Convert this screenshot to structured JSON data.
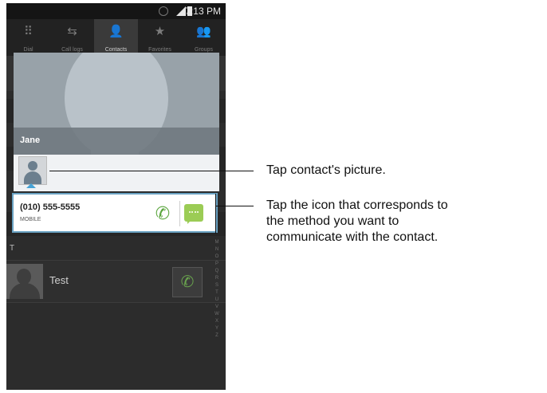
{
  "status_bar": {
    "time": "7:13 PM"
  },
  "tabs": [
    {
      "label": "Dial",
      "icon": "dialpad-icon"
    },
    {
      "label": "Call logs",
      "icon": "call-logs-icon"
    },
    {
      "label": "Contacts",
      "icon": "contacts-icon"
    },
    {
      "label": "Favorites",
      "icon": "star-icon"
    },
    {
      "label": "Groups",
      "icon": "groups-icon"
    }
  ],
  "popup": {
    "contact_name": "Jane",
    "phone_number": "(010) 555-5555",
    "phone_type": "MOBILE"
  },
  "list": {
    "section_letter": "T",
    "contact_name": "Test"
  },
  "alphabet": [
    "M",
    "N",
    "O",
    "P",
    "Q",
    "R",
    "S",
    "T",
    "U",
    "V",
    "W",
    "X",
    "Y",
    "Z"
  ],
  "callouts": {
    "picture": "Tap contact's picture.",
    "method_line1": "Tap the icon that corresponds to",
    "method_line2": "the method you want to",
    "method_line3": "communicate with the contact."
  }
}
